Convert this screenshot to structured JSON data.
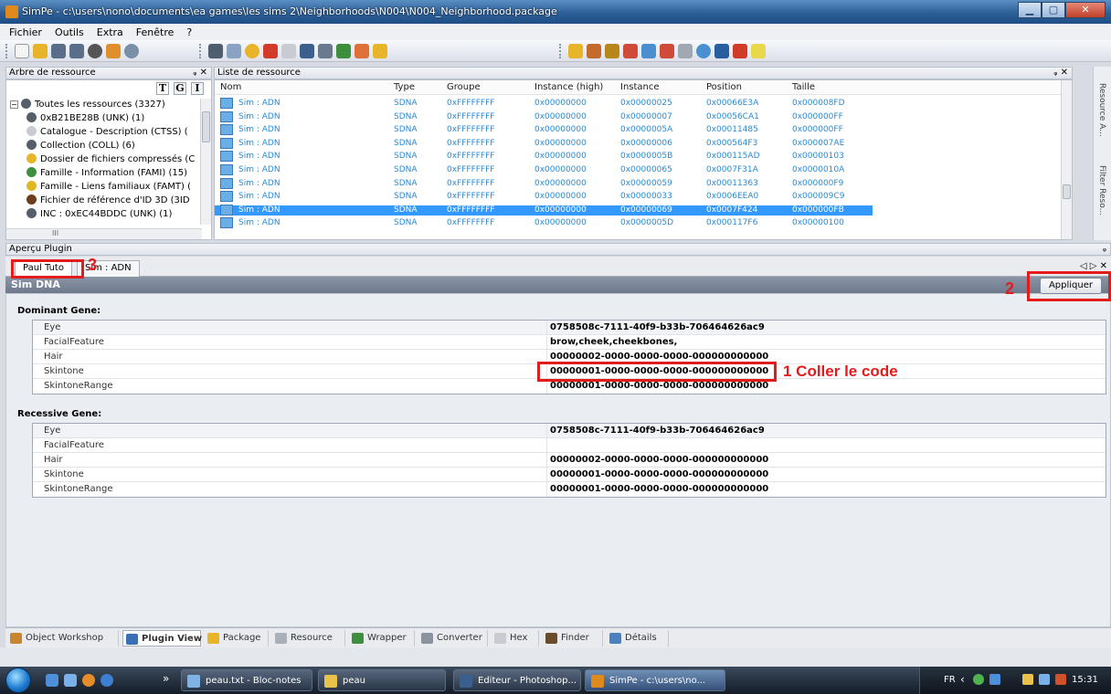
{
  "window": {
    "title": "SimPe - c:\\users\\nono\\documents\\ea games\\les sims 2\\Neighborhoods\\N004\\N004_Neighborhood.package",
    "min": "▁",
    "max": "▢",
    "close": "✕"
  },
  "menu": [
    "Fichier",
    "Outils",
    "Extra",
    "Fenêtre",
    "?"
  ],
  "tree_panel": {
    "title": "Arbre de ressource",
    "pin": "ᵩ ✕",
    "buttons": [
      "T",
      "G",
      "I"
    ],
    "items": [
      {
        "label": "Toutes les ressources (3327)",
        "color": "#555e6a"
      },
      {
        "label": "0xB21BE28B (UNK) (1)",
        "color": "#555e6a"
      },
      {
        "label": "Catalogue - Description (CTSS) (",
        "color": "#c8ccd2"
      },
      {
        "label": "Collection (COLL) (6)",
        "color": "#555e6a"
      },
      {
        "label": "Dossier de fichiers compressés (C",
        "color": "#e8b52a"
      },
      {
        "label": "Famille - Information (FAMI) (15)",
        "color": "#3d8f3d"
      },
      {
        "label": "Famille - Liens familiaux (FAMT) (",
        "color": "#e0b81f"
      },
      {
        "label": "Fichier de référence d'ID 3D (3ID",
        "color": "#6f3d1e"
      },
      {
        "label": "INC : 0xEC44BDDC (UNK) (1)",
        "color": "#555e6a"
      }
    ],
    "hscroll_label": "III"
  },
  "res_panel": {
    "title": "Liste de ressource",
    "pin": "ᵩ ✕",
    "columns": [
      "Nom",
      "Type",
      "Groupe",
      "Instance (high)",
      "Instance",
      "Position",
      "Taille"
    ],
    "rows": [
      [
        "Sim : ADN",
        "SDNA",
        "0xFFFFFFFF",
        "0x00000000",
        "0x00000025",
        "0x00066E3A",
        "0x000008FD"
      ],
      [
        "Sim : ADN",
        "SDNA",
        "0xFFFFFFFF",
        "0x00000000",
        "0x00000007",
        "0x00056CA1",
        "0x000000FF"
      ],
      [
        "Sim : ADN",
        "SDNA",
        "0xFFFFFFFF",
        "0x00000000",
        "0x0000005A",
        "0x00011485",
        "0x000000FF"
      ],
      [
        "Sim : ADN",
        "SDNA",
        "0xFFFFFFFF",
        "0x00000000",
        "0x00000006",
        "0x000564F3",
        "0x000007AE"
      ],
      [
        "Sim : ADN",
        "SDNA",
        "0xFFFFFFFF",
        "0x00000000",
        "0x0000005B",
        "0x000115AD",
        "0x00000103"
      ],
      [
        "Sim : ADN",
        "SDNA",
        "0xFFFFFFFF",
        "0x00000000",
        "0x00000065",
        "0x0007F31A",
        "0x0000010A"
      ],
      [
        "Sim : ADN",
        "SDNA",
        "0xFFFFFFFF",
        "0x00000000",
        "0x00000059",
        "0x00011363",
        "0x000000F9"
      ],
      [
        "Sim : ADN",
        "SDNA",
        "0xFFFFFFFF",
        "0x00000000",
        "0x00000033",
        "0x0006EEA0",
        "0x000009C9"
      ],
      [
        "Sim : ADN",
        "SDNA",
        "0xFFFFFFFF",
        "0x00000000",
        "0x00000069",
        "0x0007F424",
        "0x000000FB"
      ],
      [
        "Sim : ADN",
        "SDNA",
        "0xFFFFFFFF",
        "0x00000000",
        "0x0000005D",
        "0x000117F6",
        "0x00000100"
      ]
    ],
    "selected_index": 8
  },
  "right_strip": {
    "top": "Resource A...",
    "bottom": "Filter Reso..."
  },
  "plugin": {
    "title": "Aperçu Plugin",
    "pin": "ᵩ",
    "tabs": [
      "Paul Tuto",
      "Sim : ADN"
    ],
    "tab_nav": "◁ ▷ ✕",
    "header": "Sim DNA",
    "apply_label": "Appliquer",
    "dominant_title": "Dominant Gene:",
    "dominant": [
      {
        "key": "Eye",
        "value": "0758508c-7111-40f9-b33b-706464626ac9"
      },
      {
        "key": "FacialFeature",
        "value": "brow,cheek,cheekbones,"
      },
      {
        "key": "Hair",
        "value": "00000002-0000-0000-0000-000000000000"
      },
      {
        "key": "Skintone",
        "value": "00000001-0000-0000-0000-000000000000"
      },
      {
        "key": "SkintoneRange",
        "value": "00000001-0000-0000-0000-000000000000"
      }
    ],
    "recessive_title": "Recessive Gene:",
    "recessive": [
      {
        "key": "Eye",
        "value": "0758508c-7111-40f9-b33b-706464626ac9"
      },
      {
        "key": "FacialFeature",
        "value": ""
      },
      {
        "key": "Hair",
        "value": "00000002-0000-0000-0000-000000000000"
      },
      {
        "key": "Skintone",
        "value": "00000001-0000-0000-0000-000000000000"
      },
      {
        "key": "SkintoneRange",
        "value": "00000001-0000-0000-0000-000000000000"
      }
    ]
  },
  "annotations": {
    "step1": "1 Coller le code",
    "step2": "2",
    "step3": "3",
    "color": "#e41b1b"
  },
  "bottom_tabs": [
    {
      "label": "Object Workshop",
      "color": "#c9852f"
    },
    {
      "label": "Plugin View",
      "color": "#3a6fb5"
    },
    {
      "label": "Package",
      "color": "#e8b52a"
    },
    {
      "label": "Resource",
      "color": "#a9b0ba"
    },
    {
      "label": "Wrapper",
      "color": "#3d8f3d"
    },
    {
      "label": "Converter",
      "color": "#8a939e"
    },
    {
      "label": "Hex",
      "color": "#c8ccd2"
    },
    {
      "label": "Finder",
      "color": "#6b4b2a"
    },
    {
      "label": "Détails",
      "color": "#4a7fc0"
    }
  ],
  "taskbar": {
    "more": "»",
    "buttons": [
      {
        "label": "peau.txt - Bloc-notes",
        "color": "#7fb3e6"
      },
      {
        "label": "peau",
        "color": "#e8c24a"
      },
      {
        "label": "Editeur - Photoshop...",
        "color": "#3a5f8f"
      },
      {
        "label": "SimPe - c:\\users\\no...",
        "color": "#e08a1e"
      }
    ],
    "lang": "FR",
    "clock": "15:31"
  }
}
